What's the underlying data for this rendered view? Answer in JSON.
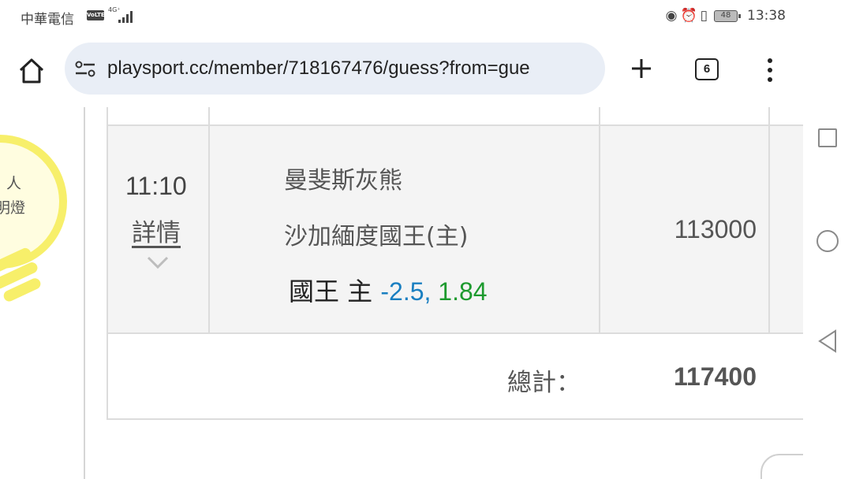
{
  "status_bar": {
    "carrier": "中華電信",
    "volte": "VoLTE",
    "network": "4G⁺",
    "battery": "48",
    "time": "13:38"
  },
  "browser": {
    "url": "playsport.cc/member/718167476/guess?from=gue",
    "tab_count": "6"
  },
  "sidebar": {
    "bulb_text_line1": "人",
    "bulb_text_line2": "明燈"
  },
  "row": {
    "time": "11:10",
    "detail_link": "詳情",
    "team_away": "曼斐斯灰熊",
    "team_home": "沙加緬度國王(主)",
    "pick_label": "國王 主 ",
    "pick_handicap": "-2.5,",
    "pick_odds": " 1.84",
    "amount": "113000"
  },
  "total": {
    "label": "總計：",
    "value": "117400"
  },
  "colors": {
    "handicap": "#1a7fc1",
    "odds": "#1d9a2e",
    "bulb": "#f7ef6a"
  }
}
